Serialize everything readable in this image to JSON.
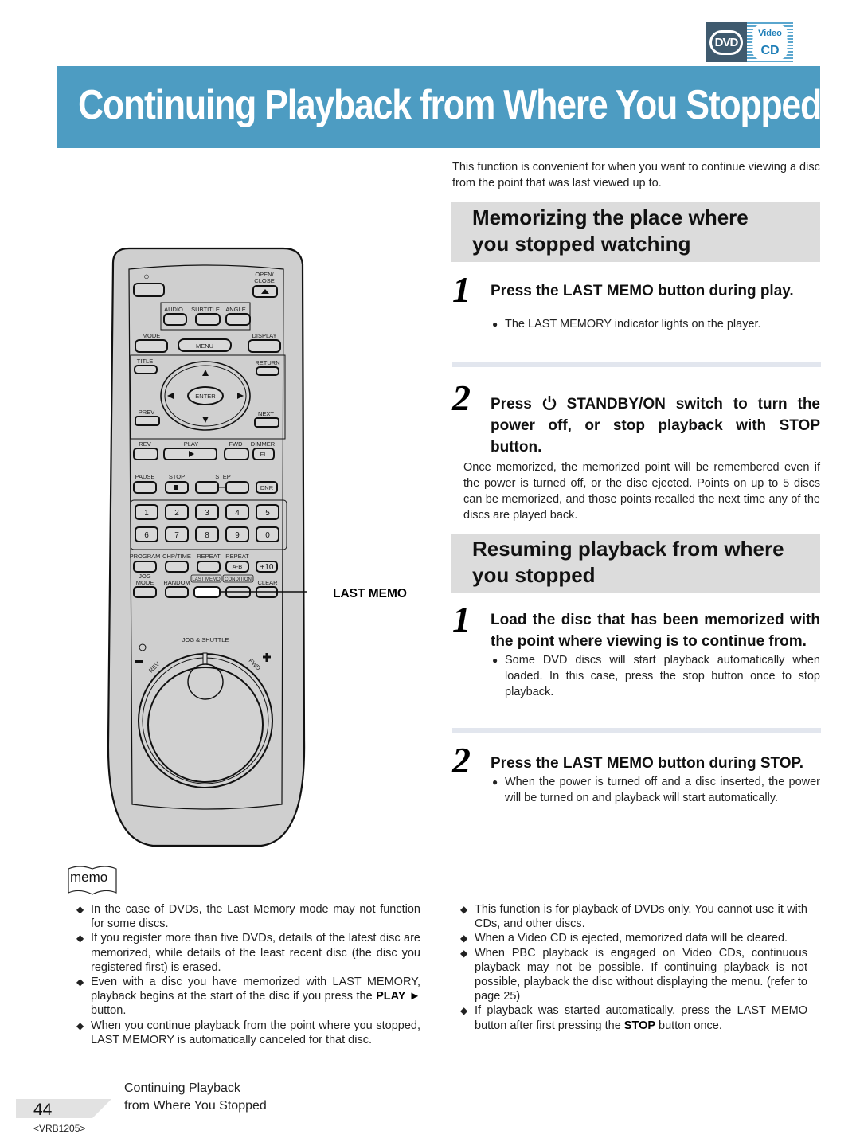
{
  "logo": {
    "dvd": "DVD",
    "video": "Video",
    "cd": "CD"
  },
  "title": "Continuing Playback from Where You Stopped",
  "intro": "This function is convenient for when you want to continue viewing a disc from the point that was last viewed up to.",
  "section1": {
    "heading_line1": "Memorizing the place where",
    "heading_line2": "you stopped watching",
    "steps": [
      {
        "num": "1",
        "title": "Press the LAST MEMO button during play.",
        "bullet": "The LAST MEMORY indicator lights on the player."
      },
      {
        "num": "2",
        "title_pre": "Press",
        "title_post": "STANDBY/ON switch to turn the power off, or stop playback with STOP button.",
        "body": "Once memorized, the memorized point will be remembered even if the power is turned off, or the disc ejected. Points on up to 5 discs can be memorized, and those points recalled the next time any of the discs are played back."
      }
    ]
  },
  "section2": {
    "heading_line1": "Resuming playback from where",
    "heading_line2": "you stopped",
    "steps": [
      {
        "num": "1",
        "title": "Load the disc that has been memorized with the point where viewing is to continue from.",
        "bullet": "Some DVD discs will start playback automatically when loaded. In this case, press the stop button once to stop playback."
      },
      {
        "num": "2",
        "title": "Press the LAST MEMO button during STOP.",
        "bullet": "When the power is turned off and a disc inserted, the power will be turned on and playback will start automatically."
      }
    ]
  },
  "remote": {
    "callout": "LAST MEMO",
    "labels": {
      "open_close_1": "OPEN/",
      "open_close_2": "CLOSE",
      "audio": "AUDIO",
      "subtitle": "SUBTITLE",
      "angle": "ANGLE",
      "mode": "MODE",
      "menu": "MENU",
      "display": "DISPLAY",
      "title": "TITLE",
      "return": "RETURN",
      "enter": "ENTER",
      "prev": "PREV",
      "next": "NEXT",
      "rev": "REV",
      "play": "PLAY",
      "fwd": "FWD",
      "dimmer": "DIMMER",
      "fl": "FL",
      "pause": "PAUSE",
      "stop": "STOP",
      "step": "STEP",
      "dnr": "DNR",
      "program": "PROGRAM",
      "chp_time": "CHP/TIME",
      "repeat": "REPEAT",
      "repeat_ab": "REPEAT",
      "ab": "A-B",
      "plus10": "+10",
      "jog_mode_1": "JOG",
      "jog_mode_2": "MODE",
      "random": "RANDOM",
      "last_memo": "LAST MEMO",
      "condition": "CONDITION",
      "clear": "CLEAR",
      "jog_shuttle": "JOG & SHUTTLE",
      "shuttle_rev": "REV",
      "shuttle_fwd": "FWD"
    },
    "digits": [
      "1",
      "2",
      "3",
      "4",
      "5",
      "6",
      "7",
      "8",
      "9",
      "0"
    ]
  },
  "memo": {
    "label": "memo",
    "left": [
      "In the case of DVDs, the Last Memory mode may not function for some discs.",
      "If you register more than five DVDs, details of the latest disc are memorized, while details of the least recent disc (the disc you registered first) is erased.",
      {
        "pre": "Even with a disc you have memorized with LAST MEMORY, playback begins at the start of the disc if you press the ",
        "bold": "PLAY ►",
        "post": " button."
      },
      "When you continue playback from the point where you stopped, LAST MEMORY is automatically canceled for that disc."
    ],
    "right": [
      "This function is for playback of DVDs only. You cannot use it with CDs, and other discs.",
      "When a Video CD is ejected, memorized data will be cleared.",
      "When PBC playback is engaged on Video CDs, continuous playback may not be possible. If continuing playback is not possible, playback the disc without displaying the menu. (refer to page 25)",
      {
        "pre": "If playback was started automatically, press the LAST MEMO button after first pressing the ",
        "bold": "STOP",
        "post": " button once."
      }
    ]
  },
  "footer": {
    "page_number": "44",
    "title_line1": "Continuing Playback",
    "title_line2": "from Where You Stopped",
    "code": "<VRB1205>"
  },
  "colors": {
    "banner": "#4d9cc2",
    "section_bg": "#dcdcdc",
    "remote_body": "#cfcfcf"
  }
}
